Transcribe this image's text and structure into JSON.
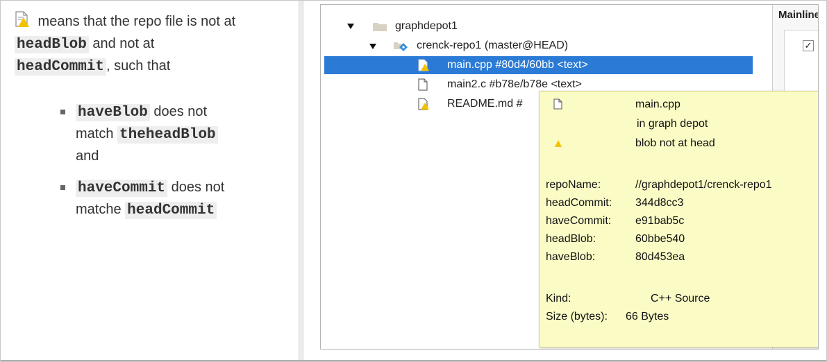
{
  "left": {
    "para_lines": [
      {
        "pre": "",
        "code": "",
        "post": " means that the repo file is not at"
      },
      {
        "pre": "",
        "code": "headBlob",
        "post": " and not at"
      },
      {
        "pre": "",
        "code": "headCommit",
        "post": ", such that"
      }
    ],
    "bullets": [
      {
        "lines": [
          {
            "code": "haveBlob",
            "post": " does not"
          },
          {
            "pre": "match ",
            "code": "theheadBlob",
            "post": ""
          },
          {
            "pre": "and",
            "code": "",
            "post": ""
          }
        ]
      },
      {
        "lines": [
          {
            "code": "haveCommit",
            "post": " does not"
          },
          {
            "pre": "matche ",
            "code": "headCommit",
            "post": ""
          }
        ]
      }
    ]
  },
  "tree": {
    "root_label": "graphdepot1",
    "repo_label": "crenck-repo1 (master@HEAD)",
    "files": [
      {
        "label": "main.cpp #80d4/60bb <text>",
        "warn": true,
        "selected": true
      },
      {
        "label": "main2.c #b78e/b78e <text>",
        "warn": false,
        "selected": false
      },
      {
        "label": "README.md #",
        "warn": true,
        "selected": false
      }
    ]
  },
  "side_panel": {
    "header": "Mainline",
    "check": "✓"
  },
  "tooltip": {
    "file_name": "main.cpp",
    "location": "in graph depot",
    "status": "blob not at head",
    "fields": [
      {
        "key": "repoName:",
        "value": "//graphdepot1/crenck-repo1"
      },
      {
        "key": "headCommit:",
        "value": "344d8cc3"
      },
      {
        "key": "haveCommit:",
        "value": "e91bab5c"
      },
      {
        "key": "headBlob:",
        "value": "60bbe540"
      },
      {
        "key": "haveBlob:",
        "value": "80d453ea"
      }
    ],
    "kind_key": "Kind:",
    "kind_value": "C++ Source",
    "size_key": "Size (bytes):",
    "size_value": "66 Bytes"
  },
  "colors": {
    "selection": "#2b7bd6",
    "tooltip_bg": "#fbfbc6",
    "warning": "#f2c200",
    "folder": "#d8d2c4",
    "code_bg": "#eeeeee"
  },
  "icons": [
    "file-warning-icon",
    "folder-icon",
    "repo-icon",
    "file-icon",
    "check-icon",
    "expand-arrow-icon"
  ]
}
